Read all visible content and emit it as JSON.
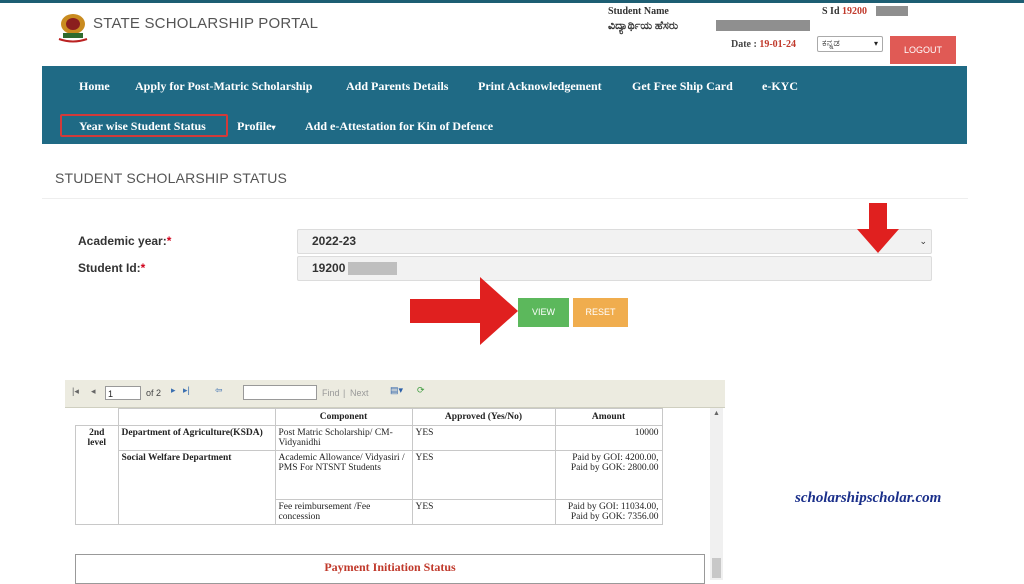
{
  "header": {
    "portal_title": "STATE SCHOLARSHIP PORTAL",
    "student_name_label": "Student Name",
    "student_name_kn": "ವಿದ್ಯಾರ್ಥಿಯ ಹೆಸರು",
    "sid_label": "S Id",
    "sid_value": "19200",
    "date_label": "Date :",
    "date_value": "19-01-24",
    "language_selected": "ಕನ್ನಡ",
    "logout_label": "LOGOUT"
  },
  "nav": {
    "items": [
      "Home",
      "Apply for Post-Matric Scholarship",
      "Add Parents Details",
      "Print Acknowledgement",
      "Get Free Ship Card",
      "e-KYC",
      "Year wise Student Status",
      "Profile",
      "Add e-Attestation for Kin of Defence"
    ]
  },
  "page": {
    "section_title": "STUDENT SCHOLARSHIP STATUS"
  },
  "form": {
    "academic_year_label": "Academic year:",
    "academic_year_value": "2022-23",
    "student_id_label": "Student Id:",
    "student_id_value": "19200",
    "required_mark": "*",
    "view_label": "VIEW",
    "reset_label": "RESET"
  },
  "report": {
    "toolbar": {
      "page_value": "1",
      "page_of": "of 2",
      "find_label": "Find",
      "next_label": "Next"
    },
    "columns": [
      "Component",
      "Approved (Yes/No)",
      "Amount"
    ],
    "rows": [
      {
        "level": "2nd level",
        "dept": "Department of Agriculture(KSDA)",
        "component": "Post Matric Scholarship/ CM-Vidyanidhi",
        "approved": "YES",
        "amount": "10000"
      },
      {
        "level": "",
        "dept": "Social Welfare Department",
        "component": "Academic Allowance/ Vidyasiri / PMS For NTSNT Students",
        "approved": "YES",
        "amount": "Paid by GOI: 4200.00, Paid by GOK: 2800.00"
      },
      {
        "level": "",
        "dept": "",
        "component": "Fee reimbursement /Fee concession",
        "approved": "YES",
        "amount": "Paid by GOI: 11034.00, Paid by GOK: 7356.00"
      }
    ],
    "payment_title": "Payment Initiation Status"
  },
  "watermark": "scholarshipscholar.com",
  "colors": {
    "navbar": "#1f6a85",
    "logout": "#e05a55",
    "view": "#5cb85c",
    "reset": "#f0ad4e",
    "arrow": "#e0201f"
  }
}
